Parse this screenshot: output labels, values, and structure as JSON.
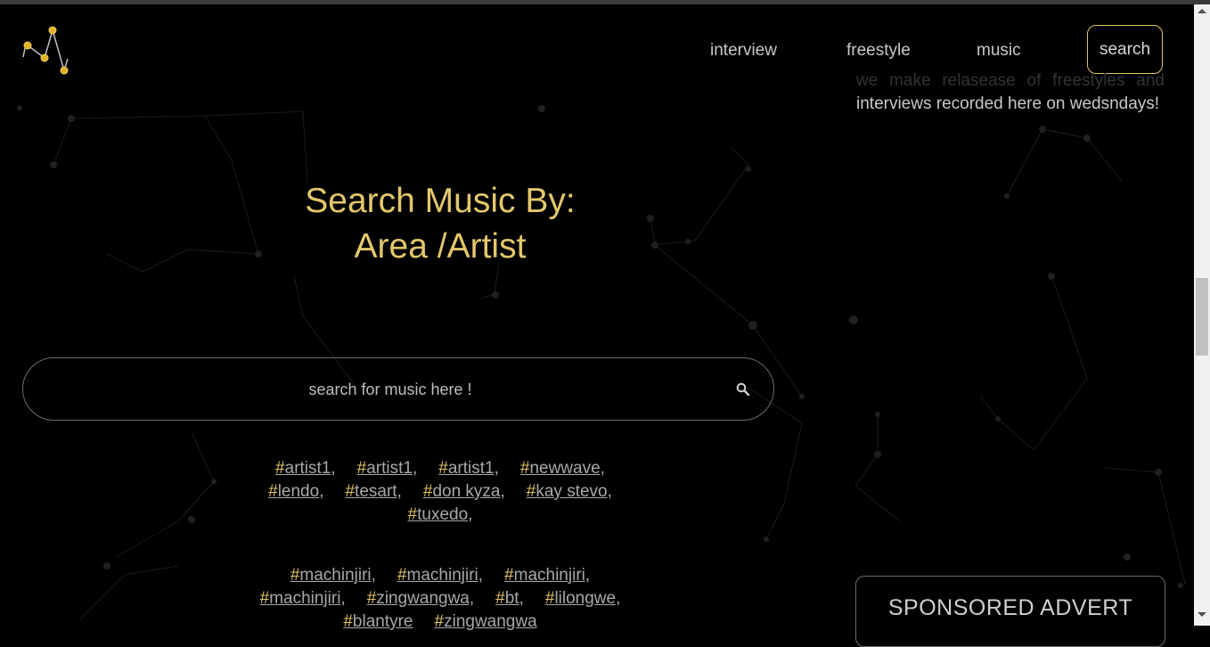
{
  "nav": {
    "items": [
      "interview",
      "freestyle",
      "music"
    ],
    "search_label": "search"
  },
  "side_text": {
    "faded": "we make relasease of freestyles and",
    "body": "interviews recorded here on wedsndays!"
  },
  "hero": {
    "line1": "Search Music By:",
    "line2": "Area /Artist"
  },
  "search": {
    "placeholder": "search for music here !"
  },
  "tags_group_1": [
    "artist1,",
    "artist1,",
    "artist1,",
    "newwave,",
    "lendo,",
    "tesart,",
    "don kyza,",
    "kay stevo,",
    "tuxedo,"
  ],
  "tags_group_2": [
    "machinjiri,",
    "machinjiri,",
    "machinjiri,",
    "machinjiri,",
    "zingwangwa,",
    "bt,",
    "lilongwe,",
    "blantyre",
    "zingwangwa"
  ],
  "ad": {
    "label": "SPONSORED ADVERT"
  },
  "colors": {
    "accent": "#e1c463",
    "background": "#000000"
  },
  "icons": {
    "logo": "constellation-logo",
    "search": "search-icon"
  }
}
